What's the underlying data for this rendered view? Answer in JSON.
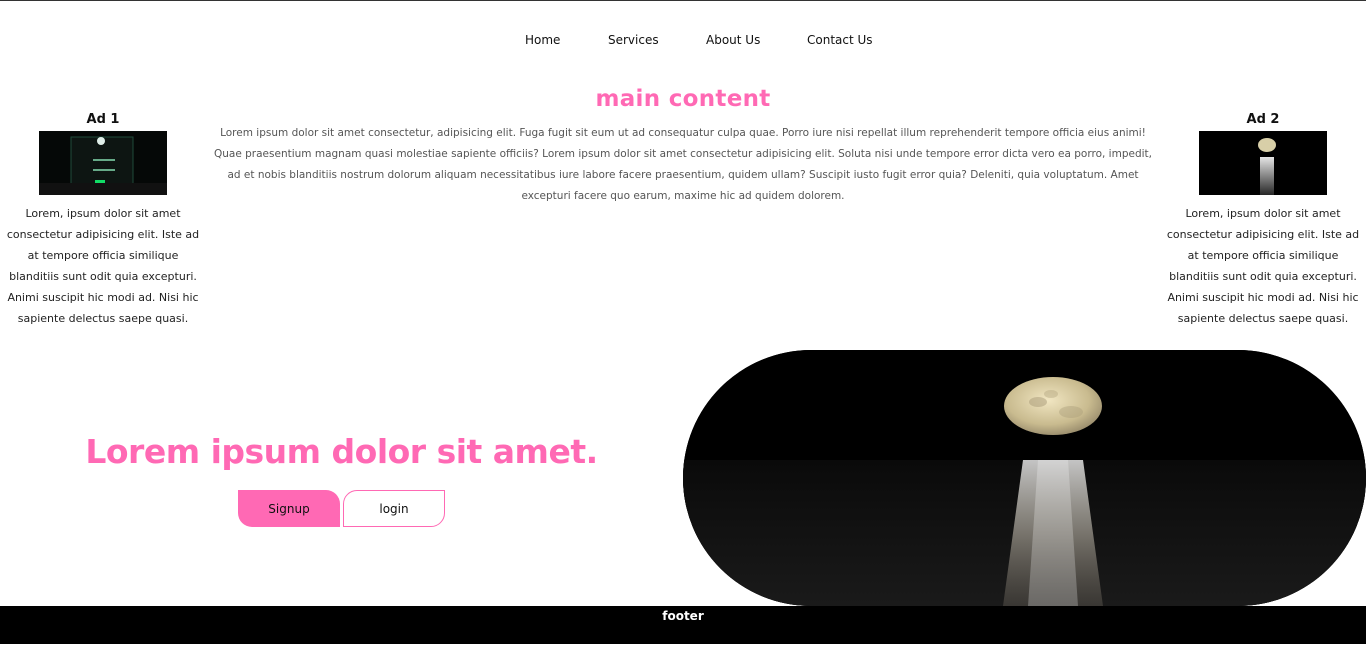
{
  "nav": {
    "items": [
      {
        "label": "Home"
      },
      {
        "label": "Services"
      },
      {
        "label": "About Us"
      },
      {
        "label": "Contact Us"
      }
    ]
  },
  "main": {
    "title": "main content",
    "text": "Lorem ipsum dolor sit amet consectetur, adipisicing elit. Fuga fugit sit eum ut ad consequatur culpa quae. Porro iure nisi repellat illum reprehenderit tempore officia eius animi! Quae praesentium magnam quasi molestiae sapiente officiis? Lorem ipsum dolor sit amet consectetur adipisicing elit. Soluta nisi unde tempore error dicta vero ea porro, impedit, ad et nobis blanditiis nostrum dolorum aliquam necessitatibus iure labore facere praesentium, quidem ullam? Suscipit iusto fugit error quia? Deleniti, quia voluptatum. Amet excepturi facere quo earum, maxime hic ad quidem dolorem."
  },
  "ads": [
    {
      "title": "Ad 1",
      "text": "Lorem, ipsum dolor sit amet consectetur adipisicing elit. Iste ad at tempore officia similique blanditiis sunt odit quia excepturi. Animi suscipit hic modi ad. Nisi hic sapiente delectus saepe quasi."
    },
    {
      "title": "Ad 2",
      "text": "Lorem, ipsum dolor sit amet consectetur adipisicing elit. Iste ad at tempore officia similique blanditiis sunt odit quia excepturi. Animi suscipit hic modi ad. Nisi hic sapiente delectus saepe quasi."
    }
  ],
  "hero": {
    "title": "Lorem ipsum dolor sit amet.",
    "signup_label": "Signup",
    "login_label": "login"
  },
  "footer": {
    "text": "footer"
  },
  "colors": {
    "accent": "#ff69b4",
    "footer_bg": "#000000"
  }
}
